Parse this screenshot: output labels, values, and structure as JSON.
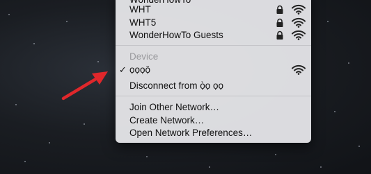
{
  "menu": {
    "partial_top_label": "WonderHowTo",
    "networks": [
      {
        "label": "WHT",
        "locked": true
      },
      {
        "label": "WHT5",
        "locked": true
      },
      {
        "label": "WonderHowTo Guests",
        "locked": true
      }
    ],
    "device_header": "Device",
    "connected_network": {
      "label": "ọọọọ̆",
      "checked": true,
      "check_mark": "✓"
    },
    "disconnect_label": "Disconnect from ọ̀ọ ọọ",
    "actions": [
      {
        "label": "Join Other Network…"
      },
      {
        "label": "Create Network…"
      },
      {
        "label": "Open Network Preferences…"
      }
    ]
  },
  "colors": {
    "menu_bg": "#e2e2e5",
    "arrow": "#e0272b",
    "header_text": "#9a9a9e"
  },
  "icons": {
    "lock": "lock-icon",
    "wifi": "wifi-icon",
    "arrow": "red-arrow-icon"
  }
}
